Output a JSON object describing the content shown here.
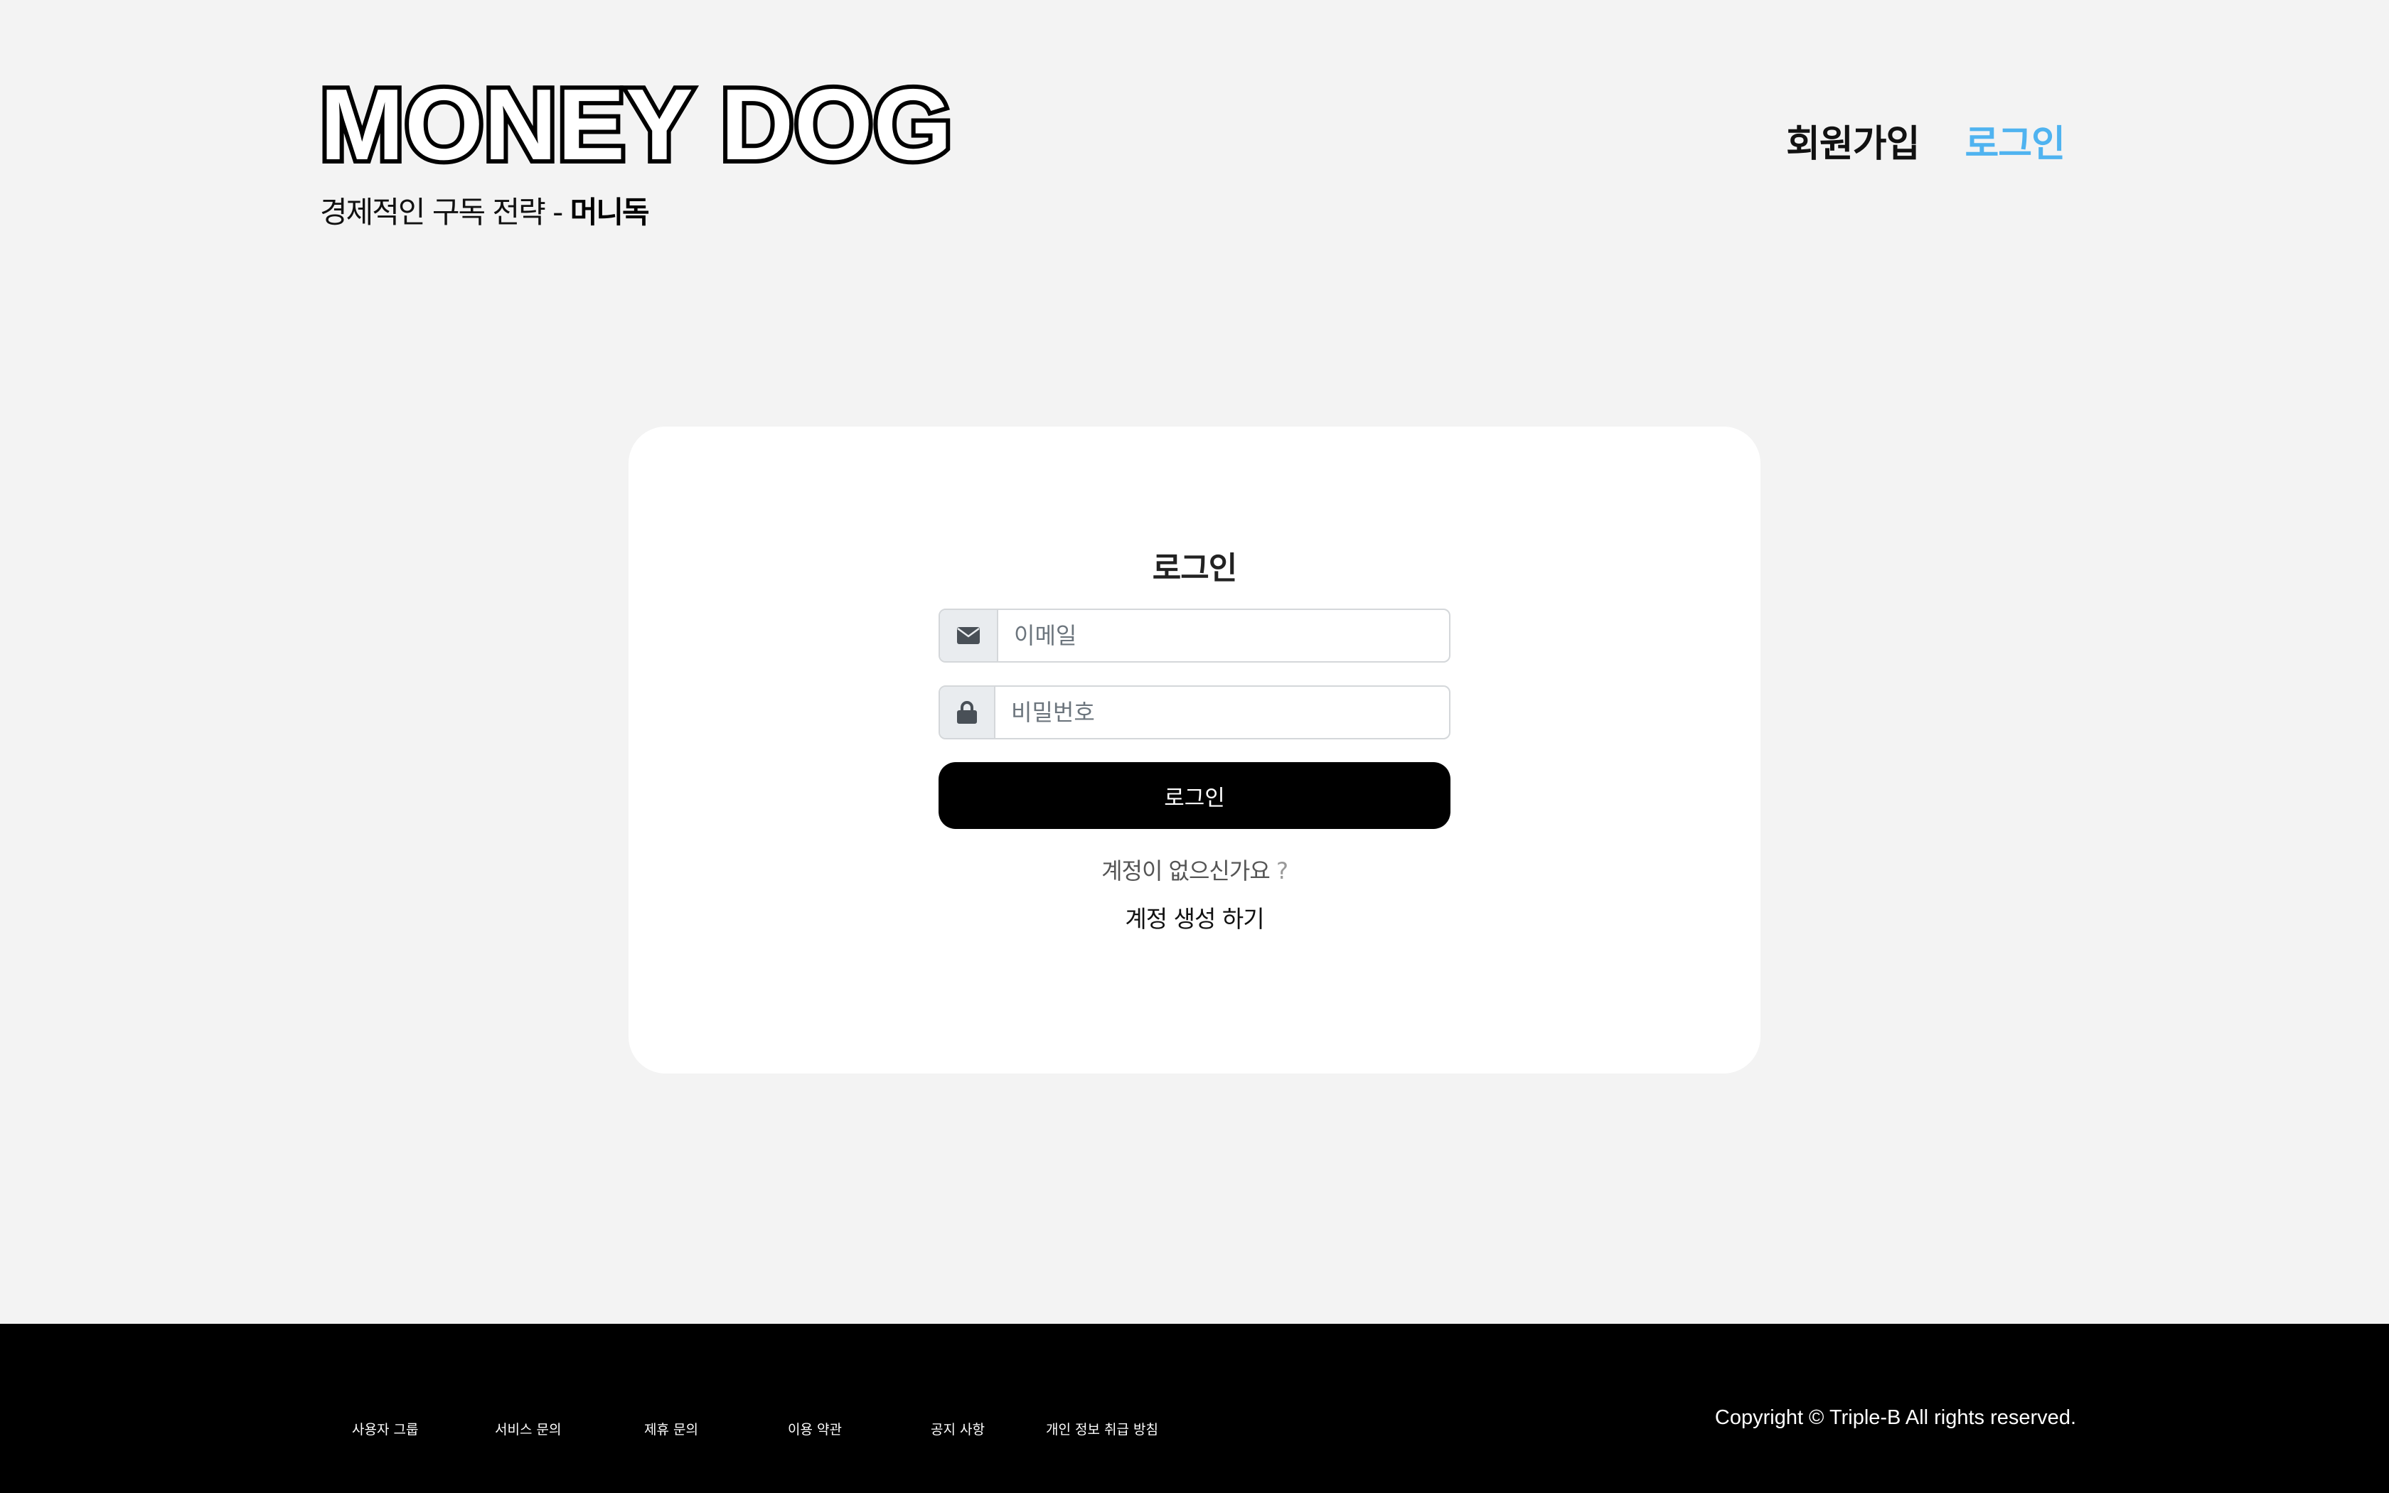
{
  "header": {
    "logo_text": "MONEY DOG",
    "tagline_prefix": "경제적인 구독 전략 - ",
    "tagline_brand": "머니독",
    "nav": {
      "signup": "회원가입",
      "login": "로그인"
    }
  },
  "login_form": {
    "title": "로그인",
    "email_placeholder": "이메일",
    "password_placeholder": "비밀번호",
    "submit_label": "로그인",
    "no_account_text": "계정이 없으신가요",
    "no_account_q": "?",
    "create_account_link": "계정 생성 하기"
  },
  "footer": {
    "links": [
      "사용자 그룹",
      "서비스 문의",
      "제휴 문의",
      "이용 약관",
      "공지 사항",
      "개인 정보 취급 방침"
    ],
    "copyright": "Copyright © Triple-B All rights reserved."
  },
  "icons": {
    "email": "envelope-icon",
    "password": "lock-icon"
  },
  "colors": {
    "accent": "#4fb3f0",
    "background": "#f3f3f3",
    "card": "#ffffff",
    "button": "#000000",
    "footer": "#000000"
  }
}
